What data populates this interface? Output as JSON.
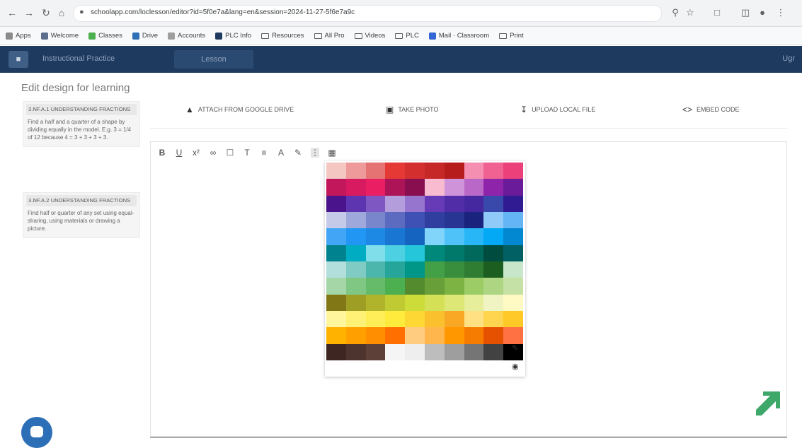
{
  "browser": {
    "url": "schoolapp.com/loclesson/editor?id=5f0e7a&lang=en&session=2024-11-27-5f6e7a9c",
    "bookmarks": [
      {
        "label": "Apps",
        "icon": "apps-icon"
      },
      {
        "label": "Welcome",
        "icon": "bookmark-icon"
      },
      {
        "label": "Classes",
        "icon": "bookmark-icon"
      },
      {
        "label": "Drive",
        "icon": "drive-icon"
      },
      {
        "label": "Accounts",
        "icon": "bookmark-icon"
      },
      {
        "label": "PLC Info",
        "icon": "bookmark-icon"
      },
      {
        "label": "Resources",
        "icon": "folder-icon"
      },
      {
        "label": "All Pro",
        "icon": "folder-icon"
      },
      {
        "label": "Videos",
        "icon": "folder-icon"
      },
      {
        "label": "PLC",
        "icon": "folder-icon"
      },
      {
        "label": "Mail · Classroom",
        "icon": "mail-icon"
      },
      {
        "label": "Print",
        "icon": "folder-icon"
      }
    ]
  },
  "app": {
    "crumb_primary": "Instructional Practice",
    "crumb_secondary": "Lesson",
    "user": "Ugr"
  },
  "page": {
    "title": "Edit design for learning"
  },
  "sidebar": {
    "cards": [
      {
        "head": "3.NF.A.1 UNDERSTANDING FRACTIONS",
        "body": "Find a half and a quarter of a shape by dividing equally in the model. E.g. 3 = 1/4 of 12 because 4 = 3 + 3 + 3 + 3."
      },
      {
        "head": "3.NF.A.2 UNDERSTANDING FRACTIONS",
        "body": "Find half or quarter of any set using equal-sharing, using materials or drawing a picture."
      }
    ]
  },
  "attach": {
    "drive_label": "ATTACH FROM GOOGLE DRIVE",
    "photo_label": "TAKE PHOTO",
    "upload_label": "UPLOAD LOCAL FILE",
    "embed_label": "EMBED CODE"
  },
  "palette": {
    "colors": [
      "#f4c7c3",
      "#ef9a9a",
      "#e57373",
      "#e53935",
      "#d32f2f",
      "#c62828",
      "#b71c1c",
      "#f48fb1",
      "#f06292",
      "#ec407a",
      "#c2185b",
      "#d81b60",
      "#e91e63",
      "#ad1457",
      "#880e4f",
      "#f8bbd0",
      "#ce93d8",
      "#ba68c8",
      "#8e24aa",
      "#6a1b9a",
      "#4a148c",
      "#5e35b1",
      "#7e57c2",
      "#b39ddb",
      "#9575cd",
      "#673ab7",
      "#512da8",
      "#4527a0",
      "#3949ab",
      "#311b92",
      "#c5cae9",
      "#9fa8da",
      "#7986cb",
      "#5c6bc0",
      "#3f51b5",
      "#303f9f",
      "#283593",
      "#1a237e",
      "#90caf9",
      "#64b5f6",
      "#42a5f5",
      "#2196f3",
      "#1e88e5",
      "#1976d2",
      "#1565c0",
      "#81d4fa",
      "#4fc3f7",
      "#29b6f6",
      "#03a9f4",
      "#0288d1",
      "#00838f",
      "#00acc1",
      "#80deea",
      "#4dd0e1",
      "#26c6da",
      "#00897b",
      "#00796b",
      "#00695c",
      "#004d40",
      "#006064",
      "#b2dfdb",
      "#80cbc4",
      "#4db6ac",
      "#26a69a",
      "#009688",
      "#43a047",
      "#388e3c",
      "#2e7d32",
      "#1b5e20",
      "#c8e6c9",
      "#a5d6a7",
      "#81c784",
      "#66bb6a",
      "#4caf50",
      "#558b2f",
      "#689f38",
      "#7cb342",
      "#9ccc65",
      "#aed581",
      "#c5e1a5",
      "#827717",
      "#9e9d24",
      "#afb42b",
      "#c0ca33",
      "#cddc39",
      "#d4e157",
      "#dce775",
      "#e6ee9c",
      "#f0f4c3",
      "#fff9c4",
      "#fff59d",
      "#fff176",
      "#ffee58",
      "#ffeb3b",
      "#fdd835",
      "#fbc02d",
      "#f9a825",
      "#ffe082",
      "#ffd54f",
      "#ffca28",
      "#ffb300",
      "#ffa000",
      "#ff8f00",
      "#ff6f00",
      "#ffcc80",
      "#ffb74d",
      "#ff9800",
      "#f57c00",
      "#e65100",
      "#ff7043",
      "#3e2723",
      "#4e342e",
      "#5d4037",
      "#f5f5f5",
      "#eeeeee",
      "#bdbdbd",
      "#9e9e9e",
      "#757575",
      "#424242",
      "#000000"
    ]
  }
}
